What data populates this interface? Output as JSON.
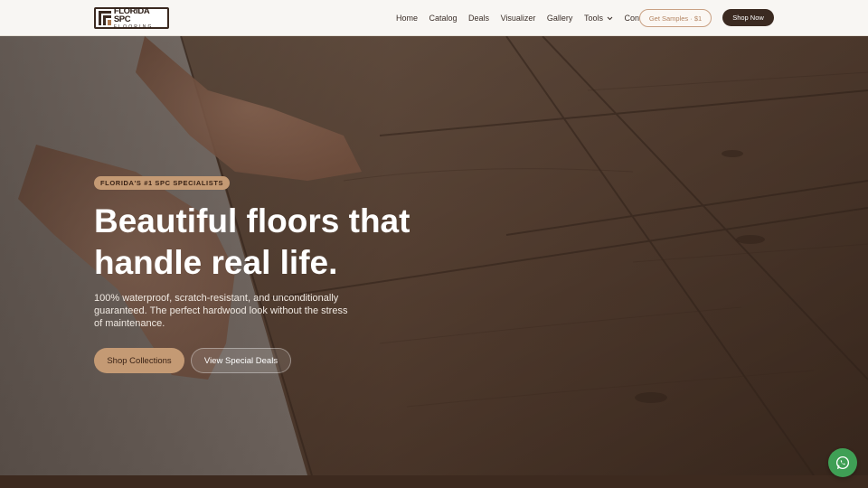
{
  "logo": {
    "top": "FLORIDA SPC",
    "bottom": "FLOORING"
  },
  "nav": {
    "items": [
      "Home",
      "Catalog",
      "Deals",
      "Visualizer",
      "Gallery",
      "Tools",
      "Contact"
    ],
    "tools_chevron": "chevron-down-icon"
  },
  "header_actions": {
    "samples_label": "Get Samples · $1",
    "shop_label": "Shop Now"
  },
  "hero": {
    "badge": "FLORIDA'S #1 SPC SPECIALISTS",
    "headline_line1": "Beautiful floors that",
    "headline_line2": "handle real life.",
    "subtext": "100% waterproof, scratch-resistant, and unconditionally guaranteed. The perfect hardwood look without the stress of maintenance.",
    "primary_cta": "Shop Collections",
    "secondary_cta": "View Special Deals"
  },
  "floating": {
    "whatsapp_icon": "whatsapp-icon"
  },
  "colors": {
    "brand_dark": "#3b2a21",
    "accent_tan": "#c49a74",
    "header_bg": "#f8f6f3",
    "whatsapp_green": "#3f9f55"
  }
}
